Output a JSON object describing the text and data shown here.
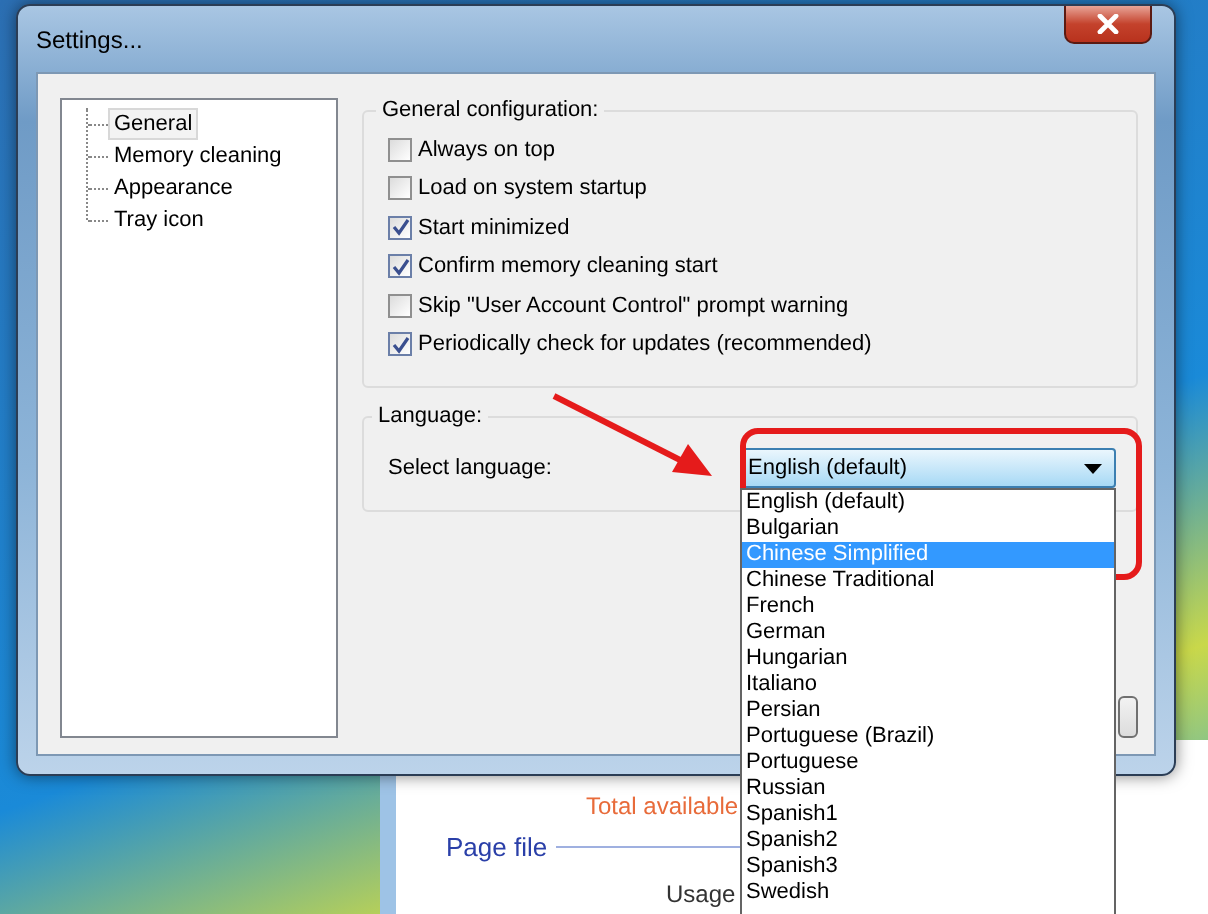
{
  "window": {
    "title": "Settings..."
  },
  "tree": {
    "items": [
      {
        "label": "General",
        "selected": true
      },
      {
        "label": "Memory cleaning",
        "selected": false
      },
      {
        "label": "Appearance",
        "selected": false
      },
      {
        "label": "Tray icon",
        "selected": false
      }
    ]
  },
  "general_group": {
    "title": "General configuration:",
    "options": [
      {
        "label": "Always on top",
        "checked": false
      },
      {
        "label": "Load on system startup",
        "checked": false
      },
      {
        "label": "Start minimized",
        "checked": true
      },
      {
        "label": "Confirm memory cleaning start",
        "checked": true
      },
      {
        "label": "Skip \"User Account Control\" prompt warning",
        "checked": false
      },
      {
        "label": "Periodically check for updates (recommended)",
        "checked": true
      }
    ]
  },
  "language_group": {
    "title": "Language:",
    "label": "Select language:",
    "value": "English (default)",
    "expanded": true,
    "options": [
      {
        "label": "English (default)",
        "highlighted": false
      },
      {
        "label": "Bulgarian",
        "highlighted": false
      },
      {
        "label": "Chinese Simplified",
        "highlighted": true
      },
      {
        "label": "Chinese Traditional",
        "highlighted": false
      },
      {
        "label": "French",
        "highlighted": false
      },
      {
        "label": "German",
        "highlighted": false
      },
      {
        "label": "Hungarian",
        "highlighted": false
      },
      {
        "label": "Italiano",
        "highlighted": false
      },
      {
        "label": "Persian",
        "highlighted": false
      },
      {
        "label": "Portuguese (Brazil)",
        "highlighted": false
      },
      {
        "label": "Portuguese",
        "highlighted": false
      },
      {
        "label": "Russian",
        "highlighted": false
      },
      {
        "label": "Spanish1",
        "highlighted": false
      },
      {
        "label": "Spanish2",
        "highlighted": false
      },
      {
        "label": "Spanish3",
        "highlighted": false
      },
      {
        "label": "Swedish",
        "highlighted": false
      }
    ]
  },
  "background_window": {
    "total_available_label": "Total available",
    "section_title": "Page file",
    "usage_label": "Usage"
  }
}
